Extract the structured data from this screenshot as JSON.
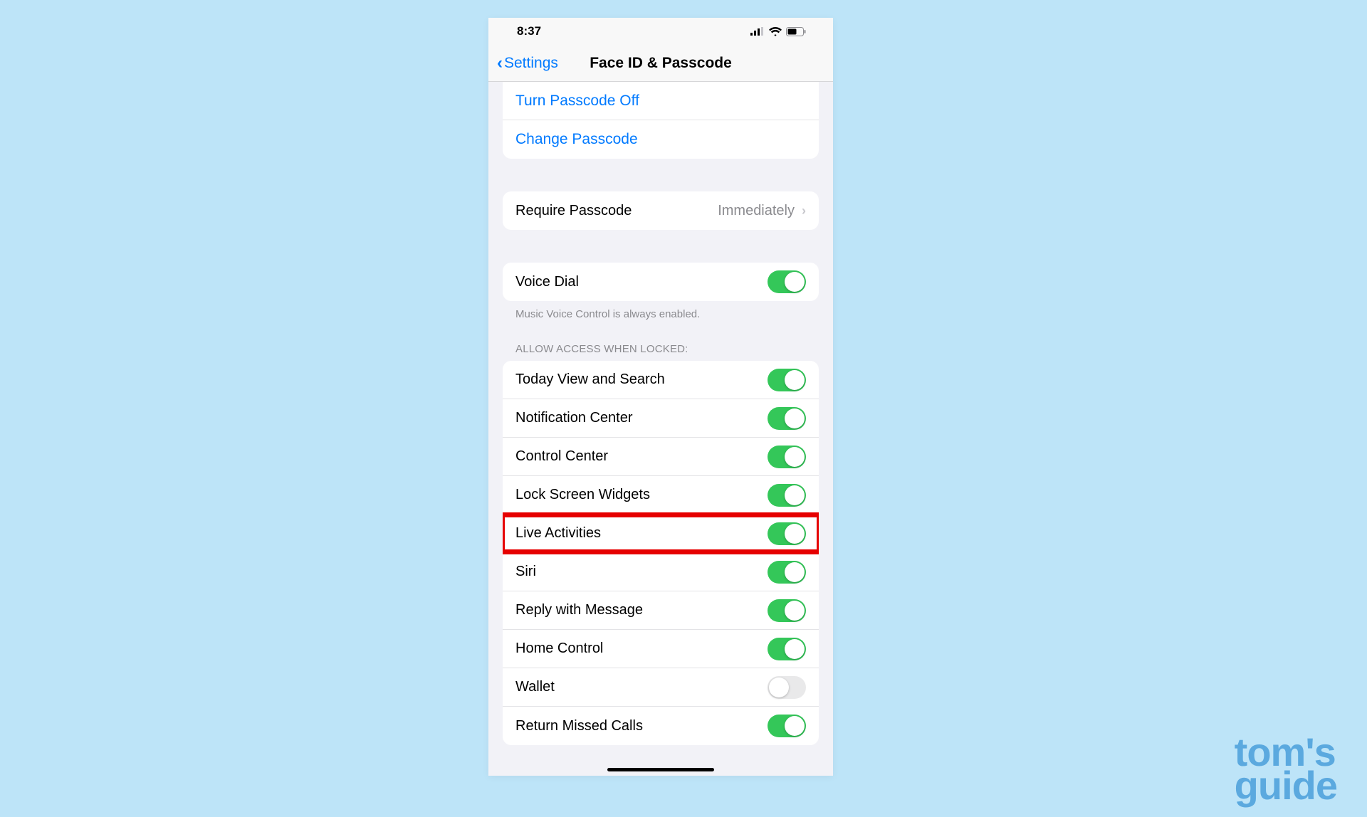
{
  "status_bar": {
    "time": "8:37"
  },
  "nav": {
    "back_label": "Settings",
    "title": "Face ID & Passcode"
  },
  "passcode_group": {
    "turn_off": "Turn Passcode Off",
    "change": "Change Passcode"
  },
  "require_group": {
    "label": "Require Passcode",
    "value": "Immediately"
  },
  "voice_dial_group": {
    "label": "Voice Dial",
    "enabled": true,
    "footer": "Music Voice Control is always enabled."
  },
  "locked_access": {
    "header": "ALLOW ACCESS WHEN LOCKED:",
    "items": [
      {
        "label": "Today View and Search",
        "enabled": true,
        "highlight": false
      },
      {
        "label": "Notification Center",
        "enabled": true,
        "highlight": false
      },
      {
        "label": "Control Center",
        "enabled": true,
        "highlight": false
      },
      {
        "label": "Lock Screen Widgets",
        "enabled": true,
        "highlight": false
      },
      {
        "label": "Live Activities",
        "enabled": true,
        "highlight": true
      },
      {
        "label": "Siri",
        "enabled": true,
        "highlight": false
      },
      {
        "label": "Reply with Message",
        "enabled": true,
        "highlight": false
      },
      {
        "label": "Home Control",
        "enabled": true,
        "highlight": false
      },
      {
        "label": "Wallet",
        "enabled": false,
        "highlight": false
      },
      {
        "label": "Return Missed Calls",
        "enabled": true,
        "highlight": false
      }
    ]
  },
  "watermark": {
    "line1": "tom's",
    "line2": "guide"
  }
}
